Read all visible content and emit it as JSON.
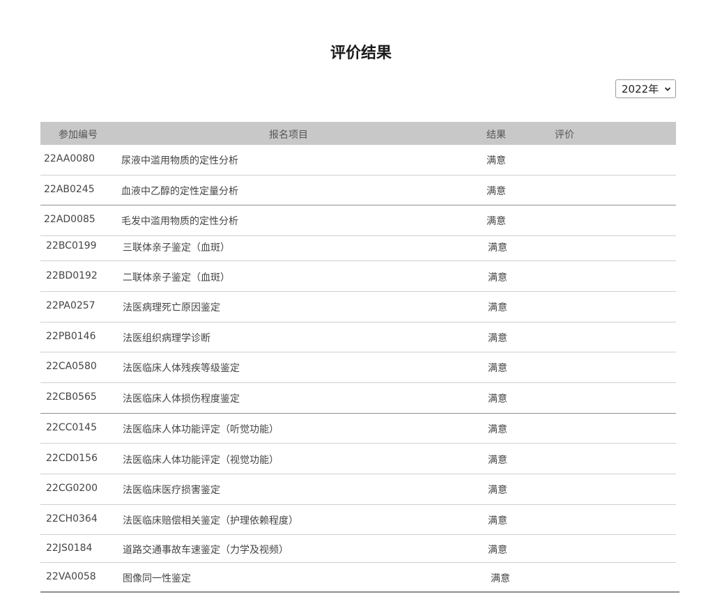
{
  "page_title": "评价结果",
  "year_select": {
    "selected": "2022年"
  },
  "table": {
    "headers": {
      "id": "参加编号",
      "item": "报名项目",
      "result": "结果",
      "evaluation": "评价"
    },
    "rows": [
      {
        "id": "22AA0080",
        "item": "尿液中滥用物质的定性分析",
        "result": "满意"
      },
      {
        "id": "22AB0245",
        "item": "血液中乙醇的定性定量分析",
        "result": "满意"
      },
      {
        "id": "22AD0085",
        "item": "毛发中滥用物质的定性分析",
        "result": "满意"
      },
      {
        "id": "22BC0199",
        "item": "三联体亲子鉴定（血斑）",
        "result": "满意"
      },
      {
        "id": "22BD0192",
        "item": "二联体亲子鉴定（血斑）",
        "result": "满意"
      },
      {
        "id": "22PA0257",
        "item": "法医病理死亡原因鉴定",
        "result": "满意"
      },
      {
        "id": "22PB0146",
        "item": "法医组织病理学诊断",
        "result": "满意"
      },
      {
        "id": "22CA0580",
        "item": "法医临床人体残疾等级鉴定",
        "result": "满意"
      },
      {
        "id": "22CB0565",
        "item": "法医临床人体损伤程度鉴定",
        "result": "满意"
      },
      {
        "id": "22CC0145",
        "item": "法医临床人体功能评定（听觉功能）",
        "result": "满意"
      },
      {
        "id": "22CD0156",
        "item": "法医临床人体功能评定（视觉功能）",
        "result": "满意"
      },
      {
        "id": "22CG0200",
        "item": "法医临床医疗损害鉴定",
        "result": "满意"
      },
      {
        "id": "22CH0364",
        "item": "法医临床赔偿相关鉴定（护理依赖程度）",
        "result": "满意"
      },
      {
        "id": "22JS0184",
        "item": "道路交通事故车速鉴定（力学及视频）",
        "result": "满意"
      },
      {
        "id": "22VA0058",
        "item": "图像同一性鉴定",
        "result": "满意"
      }
    ]
  }
}
